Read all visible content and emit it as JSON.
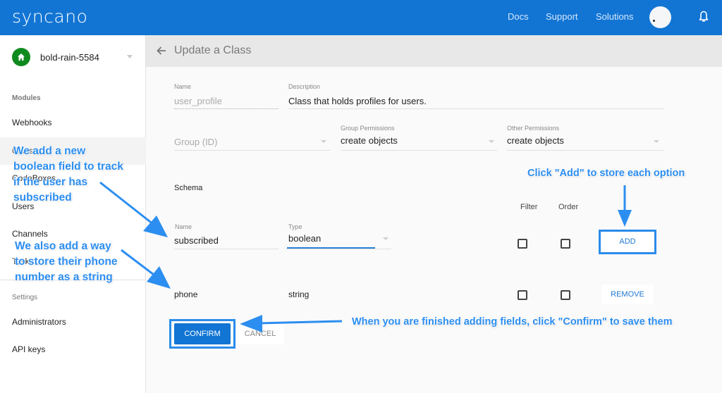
{
  "topbar": {
    "logo": "syncano",
    "links": [
      "Docs",
      "Support",
      "Solutions"
    ],
    "brand_color": "#1275d4"
  },
  "sidebar": {
    "instance": {
      "name": "bold-rain-5584",
      "icon": "home-icon",
      "badge_color": "#0f8a1f"
    },
    "sections": [
      {
        "heading": "Modules",
        "items": [
          "Webhooks",
          "Classes",
          "CodeBoxes",
          "Users",
          "Channels",
          "Tasks"
        ]
      },
      {
        "heading": "Settings",
        "items": [
          "Administrators",
          "API keys"
        ]
      }
    ]
  },
  "header": {
    "title": "Update a Class",
    "back_icon": "arrow-left-icon"
  },
  "form": {
    "name": {
      "label": "Name",
      "value": "user_profile"
    },
    "description": {
      "label": "Description",
      "value": "Class that holds profiles for users."
    },
    "group": {
      "label": "",
      "placeholder": "Group (ID)"
    },
    "group_permissions": {
      "label": "Group Permissions",
      "value": "create objects"
    },
    "other_permissions": {
      "label": "Other Permissions",
      "value": "create objects"
    },
    "schema_label": "Schema",
    "new_field": {
      "name_label": "Name",
      "name_value": "subscribed",
      "type_label": "Type",
      "type_value": "boolean",
      "filter_label": "Filter",
      "order_label": "Order",
      "filter_checked": false,
      "order_checked": false,
      "add_label": "ADD"
    },
    "fields": [
      {
        "name": "phone",
        "type": "string",
        "filter": false,
        "order": false,
        "remove_label": "REMOVE"
      }
    ],
    "confirm_label": "CONFIRM",
    "cancel_label": "CANCEL"
  },
  "annotations": {
    "note1": [
      "We add a new",
      "boolean field to track",
      "if the user has",
      "subscribed"
    ],
    "note2": [
      "We also add a way",
      "to store their phone",
      "number as a string"
    ],
    "note3": "Click \"Add\" to store each option",
    "note4": "When you are finished adding fields, click \"Confirm\" to save them",
    "color": "#2c8ef0"
  }
}
